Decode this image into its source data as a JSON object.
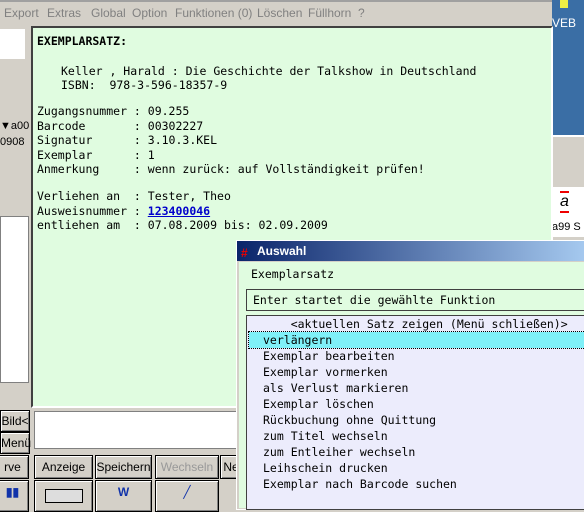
{
  "menu": [
    "Export",
    "Extras",
    "Global",
    "Option",
    "Funktionen (0)",
    "Löschen",
    "Füllhorn",
    "?"
  ],
  "desktop": {
    "label_top": "VEB",
    "label_bottom": "a99 S"
  },
  "left": {
    "row1": "▼a00",
    "row2": "0908",
    "bild_button": "Bild<",
    "menu_button": "Menü"
  },
  "record": {
    "heading": "EXEMPLARSATZ:",
    "author_title": "Keller , Harald : Die Geschichte der Talkshow in Deutschland",
    "isbn": "ISBN:  978-3-596-18357-9",
    "fields": [
      {
        "label": "Zugangsnummer : ",
        "value": "09.255"
      },
      {
        "label": "Barcode       : ",
        "value": "00302227"
      },
      {
        "label": "Signatur      : ",
        "value": "3.10.3.KEL"
      },
      {
        "label": "Exemplar      : ",
        "value": "1"
      },
      {
        "label": "Anmerkung     : ",
        "value": "wenn zurück: auf Vollständigkeit prüfen!"
      }
    ],
    "borrowed_to_label": "Verliehen an  : ",
    "borrowed_to": "Tester, Theo",
    "card_label": "Ausweisnummer : ",
    "card_number": "123400046",
    "lent_label": "entliehen am  : ",
    "lent_value": "07.08.2009 bis: 02.09.2009"
  },
  "buttons": {
    "reserve": "rve",
    "anzeige": "Anzeige",
    "speichern": "Speichern",
    "wechseln": "Wechseln",
    "neu": "Ne"
  },
  "dialog": {
    "title": "Auswahl",
    "subtitle": "Exemplarsatz",
    "hint": "Enter startet die gewählte Funktion",
    "items": [
      "    <aktuellen Satz zeigen (Menü schließen)>",
      "verlängern",
      "Exemplar bearbeiten",
      "Exemplar vormerken",
      "als Verlust markieren",
      "Exemplar löschen",
      "Rückbuchung ohne Quittung",
      "zum Titel wechseln",
      "zum Entleiher wechseln",
      "Leihschein drucken",
      "Exemplar nach Barcode suchen"
    ],
    "selected": 1
  }
}
